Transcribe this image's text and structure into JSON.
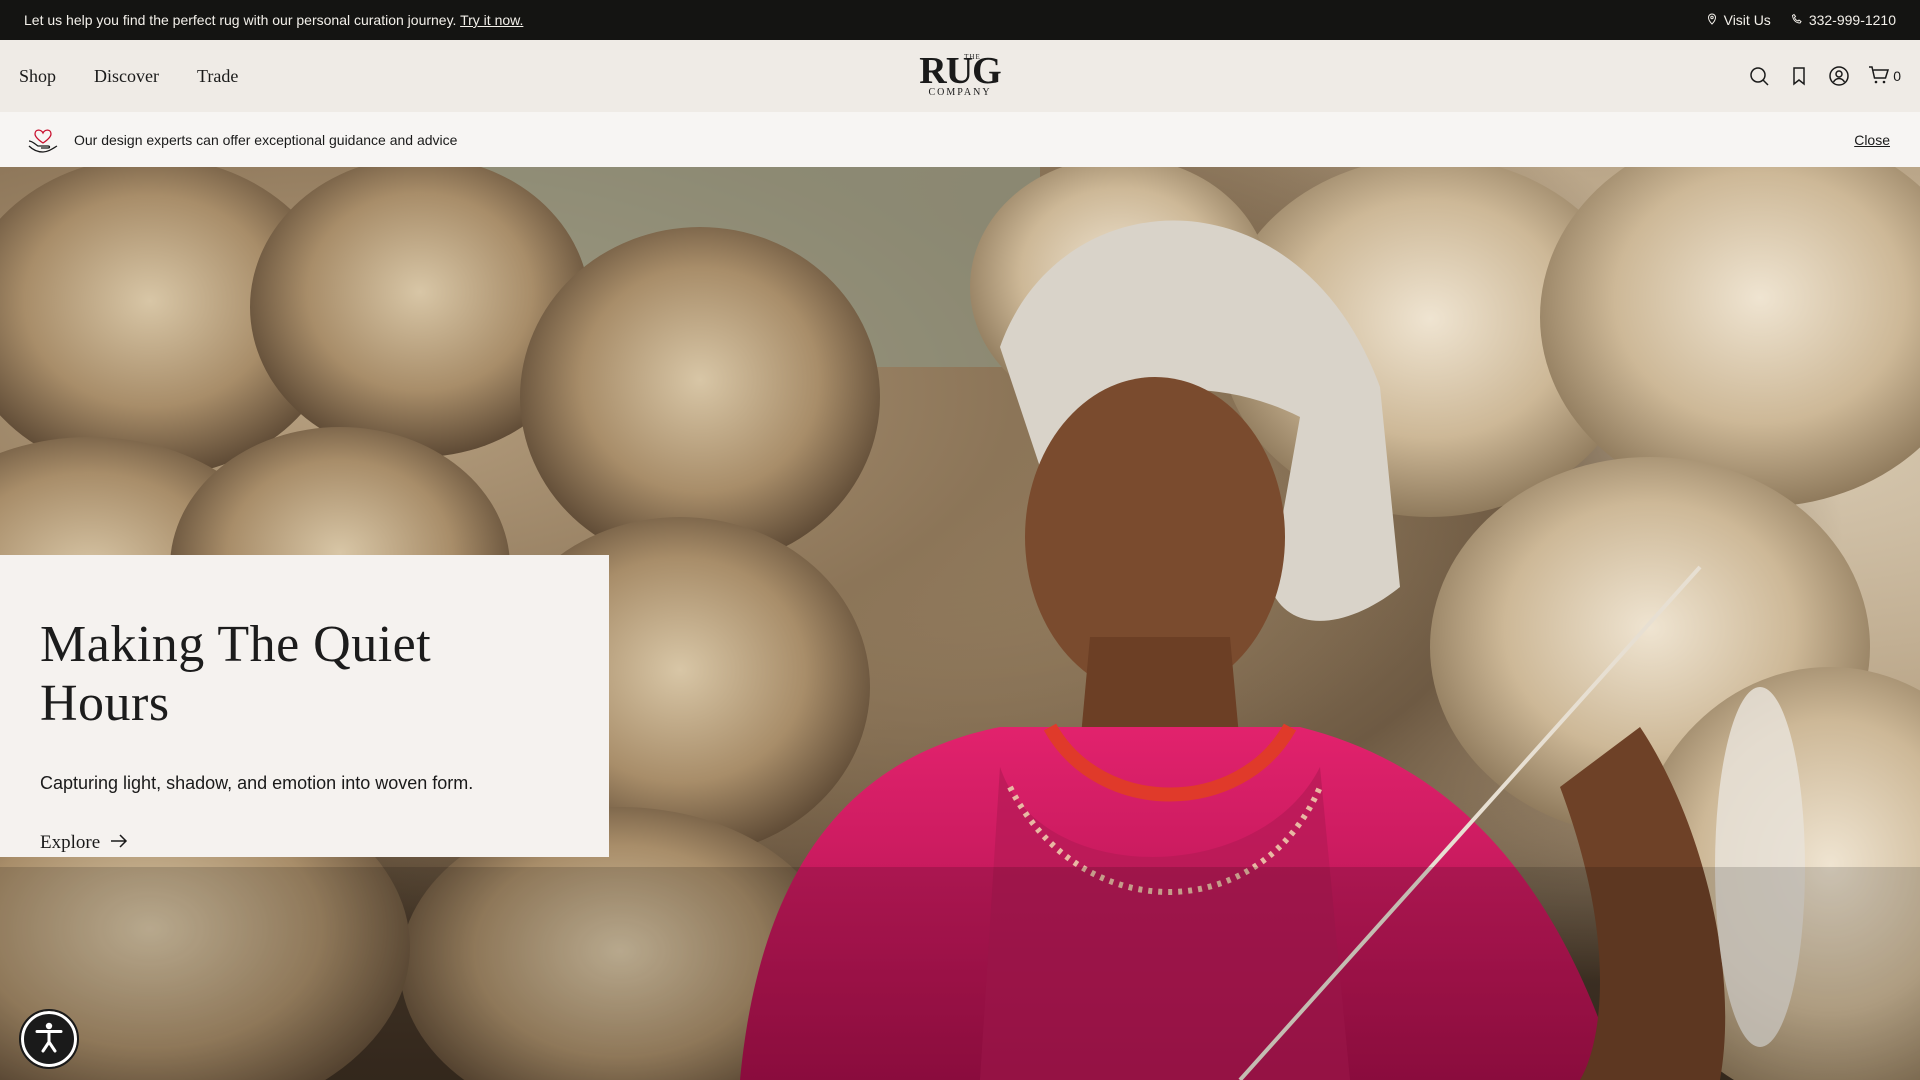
{
  "topbar": {
    "message": "Let us help you find the perfect rug with our personal curation journey.",
    "cta": "Try it now.",
    "visit_label": "Visit Us",
    "phone": "332-999-1210"
  },
  "header": {
    "nav": [
      "Shop",
      "Discover",
      "Trade"
    ],
    "logo": {
      "the": "THE",
      "rug": "RUG",
      "company": "COMPANY"
    },
    "cart_count": "0"
  },
  "advice": {
    "text": "Our design experts can offer exceptional guidance and advice",
    "close_label": "Close"
  },
  "hero": {
    "title": "Making The Quiet Hours",
    "subtitle": "Capturing light, shadow, and emotion into woven form.",
    "cta": "Explore"
  },
  "colors": {
    "topbar_bg": "#141412",
    "header_bg": "#efebe6",
    "card_bg": "#f5f2ef",
    "garment_pink": "#d0185f"
  },
  "icons": [
    "location-pin-icon",
    "phone-icon",
    "search-icon",
    "bookmark-icon",
    "account-icon",
    "cart-icon",
    "heart-hand-icon",
    "arrow-right-icon",
    "accessibility-icon"
  ]
}
